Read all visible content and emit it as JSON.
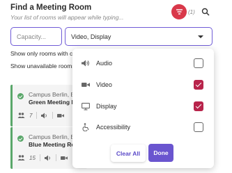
{
  "header": {
    "title": "Find a Meeting Room",
    "subtitle": "Your list of rooms will appear while typing...",
    "filter_count": "(1)"
  },
  "filters": {
    "capacity_placeholder": "Capacity...",
    "capacity_value": "",
    "equipment_value": "Video, Display"
  },
  "options": {
    "only_rooms": "Show only rooms with cat",
    "unavailable_rooms": "Show unavailable rooms"
  },
  "rooms": [
    {
      "location": "Campus Berlin, Bu",
      "name": "Green Meeting Ro",
      "capacity": "7"
    },
    {
      "location": "Campus Berlin, Bu",
      "name": "Blue Meeting Roo",
      "capacity": "15"
    }
  ],
  "dropdown": {
    "items": [
      {
        "label": "Audio",
        "icon": "speaker-icon",
        "checked": false
      },
      {
        "label": "Video",
        "icon": "video-camera-icon",
        "checked": true
      },
      {
        "label": "Display",
        "icon": "monitor-icon",
        "checked": true
      },
      {
        "label": "Accessibility",
        "icon": "accessibility-icon",
        "checked": false
      }
    ],
    "clear_label": "Clear All",
    "done_label": "Done"
  },
  "colors": {
    "accent": "#6a55cf",
    "filter_active": "#d9384a",
    "checkbox_checked": "#b8244b",
    "available": "#5aa76a"
  }
}
